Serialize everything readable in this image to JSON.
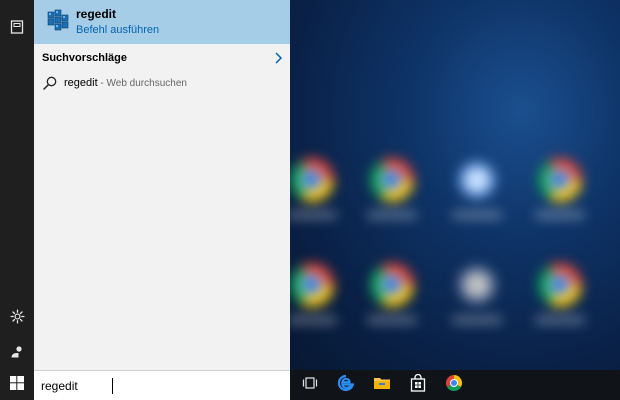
{
  "best_match": {
    "title": "regedit",
    "subtitle": "Befehl ausführen",
    "icon": "registry-editor-icon"
  },
  "suggestions": {
    "header": "Suchvorschläge",
    "items": [
      {
        "query": "regedit",
        "hint": " - Web durchsuchen",
        "icon": "search-icon"
      }
    ]
  },
  "search": {
    "value": "regedit"
  },
  "left_rail": {
    "items": [
      {
        "icon": "notebook-icon"
      },
      {
        "icon": "gear-icon"
      },
      {
        "icon": "feedback-icon"
      }
    ]
  },
  "taskbar": {
    "items": [
      {
        "icon": "task-view-icon"
      },
      {
        "icon": "edge-icon"
      },
      {
        "icon": "file-explorer-icon"
      },
      {
        "icon": "store-icon"
      },
      {
        "icon": "chrome-icon"
      }
    ]
  },
  "colors": {
    "best_match_bg": "#a6cde8",
    "accent_link": "#0063b1",
    "panel_bg": "#f2f2f2",
    "rail_bg": "#1f1f1f",
    "taskbar_bg": "#101418"
  }
}
